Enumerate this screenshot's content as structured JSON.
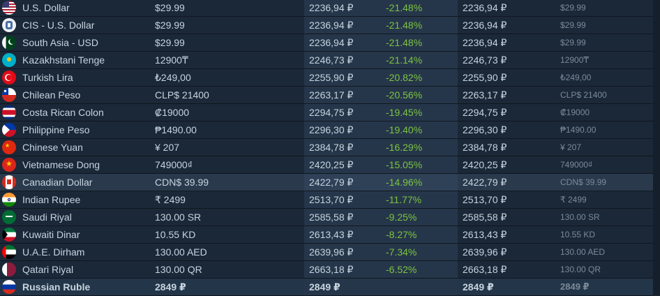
{
  "colors": {
    "background": "#1b2838",
    "highlight": "#2a3a4c",
    "diff_green": "#7bc443",
    "muted": "#7b8a9a"
  },
  "rows": [
    {
      "name": "U.S. Dollar",
      "price": "$29.99",
      "converted": "2236,94 ₽",
      "diff": "-21.48%",
      "converted2": "2236,94 ₽",
      "original": "$29.99",
      "flag": "us-flag-icon"
    },
    {
      "name": "CIS - U.S. Dollar",
      "price": "$29.99",
      "converted": "2236,94 ₽",
      "diff": "-21.48%",
      "converted2": "2236,94 ₽",
      "original": "$29.99",
      "flag": "cis-flag-icon"
    },
    {
      "name": "South Asia - USD",
      "price": "$29.99",
      "converted": "2236,94 ₽",
      "diff": "-21.48%",
      "converted2": "2236,94 ₽",
      "original": "$29.99",
      "flag": "pk-flag-icon"
    },
    {
      "name": "Kazakhstani Tenge",
      "price": "12900₸",
      "converted": "2246,73 ₽",
      "diff": "-21.14%",
      "converted2": "2246,73 ₽",
      "original": "12900₸",
      "flag": "kz-flag-icon"
    },
    {
      "name": "Turkish Lira",
      "price": "₺249,00",
      "converted": "2255,90 ₽",
      "diff": "-20.82%",
      "converted2": "2255,90 ₽",
      "original": "₺249,00",
      "flag": "tr-flag-icon"
    },
    {
      "name": "Chilean Peso",
      "price": "CLP$ 21400",
      "converted": "2263,17 ₽",
      "diff": "-20.56%",
      "converted2": "2263,17 ₽",
      "original": "CLP$ 21400",
      "flag": "cl-flag-icon"
    },
    {
      "name": "Costa Rican Colon",
      "price": "₡19000",
      "converted": "2294,75 ₽",
      "diff": "-19.45%",
      "converted2": "2294,75 ₽",
      "original": "₡19000",
      "flag": "cr-flag-icon"
    },
    {
      "name": "Philippine Peso",
      "price": "₱1490.00",
      "converted": "2296,30 ₽",
      "diff": "-19.40%",
      "converted2": "2296,30 ₽",
      "original": "₱1490.00",
      "flag": "ph-flag-icon"
    },
    {
      "name": "Chinese Yuan",
      "price": "¥ 207",
      "converted": "2384,78 ₽",
      "diff": "-16.29%",
      "converted2": "2384,78 ₽",
      "original": "¥ 207",
      "flag": "cn-flag-icon"
    },
    {
      "name": "Vietnamese Dong",
      "price": "749000₫",
      "converted": "2420,25 ₽",
      "diff": "-15.05%",
      "converted2": "2420,25 ₽",
      "original": "749000₫",
      "flag": "vn-flag-icon"
    },
    {
      "name": "Canadian Dollar",
      "price": "CDN$ 39.99",
      "converted": "2422,79 ₽",
      "diff": "-14.96%",
      "converted2": "2422,79 ₽",
      "original": "CDN$ 39.99",
      "flag": "ca-flag-icon"
    },
    {
      "name": "Indian Rupee",
      "price": "₹ 2499",
      "converted": "2513,70 ₽",
      "diff": "-11.77%",
      "converted2": "2513,70 ₽",
      "original": "₹ 2499",
      "flag": "in-flag-icon"
    },
    {
      "name": "Saudi Riyal",
      "price": "130.00 SR",
      "converted": "2585,58 ₽",
      "diff": "-9.25%",
      "converted2": "2585,58 ₽",
      "original": "130.00 SR",
      "flag": "sa-flag-icon"
    },
    {
      "name": "Kuwaiti Dinar",
      "price": "10.55 KD",
      "converted": "2613,43 ₽",
      "diff": "-8.27%",
      "converted2": "2613,43 ₽",
      "original": "10.55 KD",
      "flag": "kw-flag-icon"
    },
    {
      "name": "U.A.E. Dirham",
      "price": "130.00 AED",
      "converted": "2639,96 ₽",
      "diff": "-7.34%",
      "converted2": "2639,96 ₽",
      "original": "130.00 AED",
      "flag": "ae-flag-icon"
    },
    {
      "name": "Qatari Riyal",
      "price": "130.00 QR",
      "converted": "2663,18 ₽",
      "diff": "-6.52%",
      "converted2": "2663,18 ₽",
      "original": "130.00 QR",
      "flag": "qa-flag-icon"
    },
    {
      "name": "Russian Ruble",
      "price": "2849 ₽",
      "converted": "2849 ₽",
      "diff": "",
      "converted2": "2849 ₽",
      "original": "2849 ₽",
      "flag": "ru-flag-icon"
    }
  ]
}
